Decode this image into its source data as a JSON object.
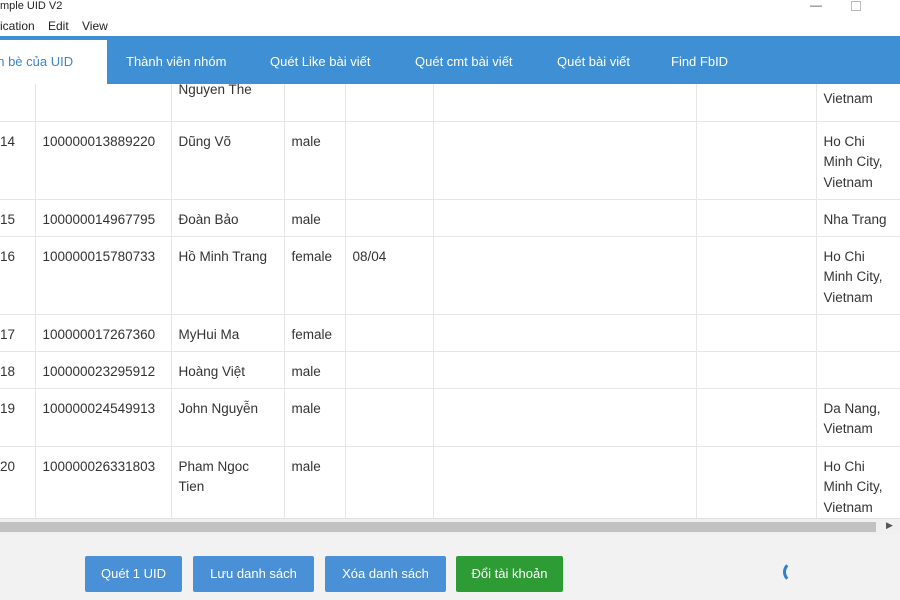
{
  "window": {
    "title": "mple UID V2"
  },
  "menu": [
    "ication",
    "Edit",
    "View"
  ],
  "tabs": [
    {
      "label": "ạn bè của UID",
      "active": true
    },
    {
      "label": "Thành viên nhóm"
    },
    {
      "label": "Quét Like bài viết"
    },
    {
      "label": "Quét cmt bài viết"
    },
    {
      "label": "Quét bài viết"
    },
    {
      "label": "Find FbID"
    }
  ],
  "table": {
    "partial_row": {
      "name": "Nguyen The",
      "location": "Vietnam"
    },
    "rows": [
      {
        "stt": "14",
        "uid": "100000013889220",
        "name": "Dũng Võ",
        "gender": "male",
        "birthday": "",
        "location": "Ho Chi Minh City, Vietnam"
      },
      {
        "stt": "15",
        "uid": "100000014967795",
        "name": "Đoàn Bảo",
        "gender": "male",
        "birthday": "",
        "location": "Nha Trang"
      },
      {
        "stt": "16",
        "uid": "100000015780733",
        "name": "Hồ Minh Trang",
        "gender": "female",
        "birthday": "08/04",
        "location": "Ho Chi Minh City, Vietnam"
      },
      {
        "stt": "17",
        "uid": "100000017267360",
        "name": "MyHui Ma",
        "gender": "female",
        "birthday": "",
        "location": ""
      },
      {
        "stt": "18",
        "uid": "100000023295912",
        "name": "Hoàng Việt",
        "gender": "male",
        "birthday": "",
        "location": ""
      },
      {
        "stt": "19",
        "uid": "100000024549913",
        "name": "John Nguyễn",
        "gender": "male",
        "birthday": "",
        "location": "Da Nang, Vietnam"
      },
      {
        "stt": "20",
        "uid": "100000026331803",
        "name": "Pham Ngoc Tien",
        "gender": "male",
        "birthday": "",
        "location": "Ho Chi Minh City, Vietnam"
      }
    ]
  },
  "footer": {
    "btn_scan": "Quét 1 UID",
    "btn_save": "Lưu danh sách",
    "btn_clear": "Xóa danh sách",
    "btn_switch": "Đổi tài khoản"
  },
  "colors": {
    "tab_bar": "#3f8fd4",
    "button_blue": "#4a90d6",
    "button_green": "#2e9c35"
  }
}
